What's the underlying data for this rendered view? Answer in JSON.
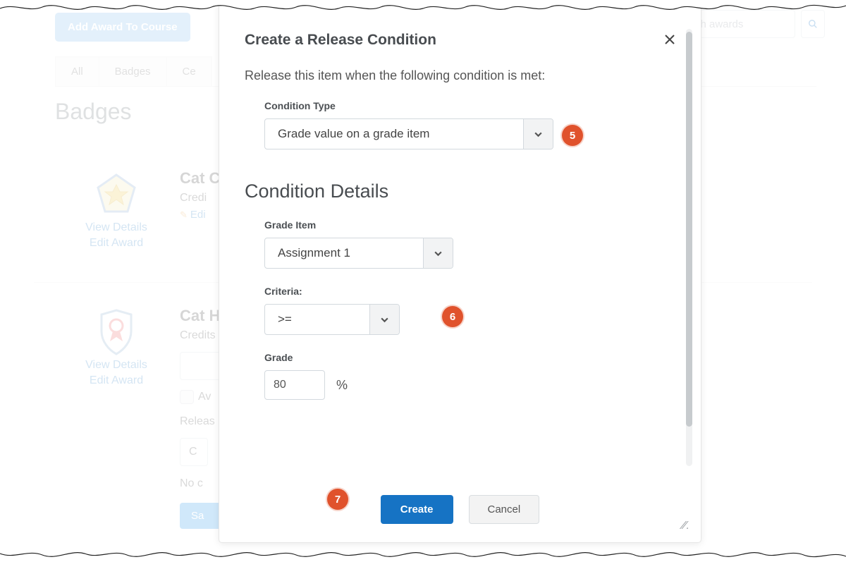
{
  "background": {
    "add_award_button": "Add Award To Course",
    "search_placeholder": "rch awards",
    "tabs": {
      "all": "All",
      "badges": "Badges",
      "certificates": "Ce"
    },
    "page_title": "Badges",
    "award1": {
      "name": "Cat C",
      "credits": "Credi",
      "edit": "Edi",
      "view_details": "View Details",
      "edit_award": "Edit Award"
    },
    "award2": {
      "name": "Cat H",
      "credits": "Credits",
      "award_check_label": "Av",
      "release": "Releas",
      "c_btn": "C",
      "no_co": "No c",
      "save": "Sa",
      "view_details": "View Details",
      "edit_award": "Edit Award"
    }
  },
  "modal": {
    "title": "Create a Release Condition",
    "subtitle": "Release this item when the following condition is met:",
    "condition_type_label": "Condition Type",
    "condition_type_value": "Grade value on a grade item",
    "details_heading": "Condition Details",
    "grade_item_label": "Grade Item",
    "grade_item_value": "Assignment 1",
    "criteria_label": "Criteria:",
    "criteria_value": ">=",
    "grade_label": "Grade",
    "grade_value": "80",
    "percent": "%",
    "create": "Create",
    "cancel": "Cancel"
  },
  "callouts": {
    "five": "5",
    "six": "6",
    "seven": "7"
  }
}
